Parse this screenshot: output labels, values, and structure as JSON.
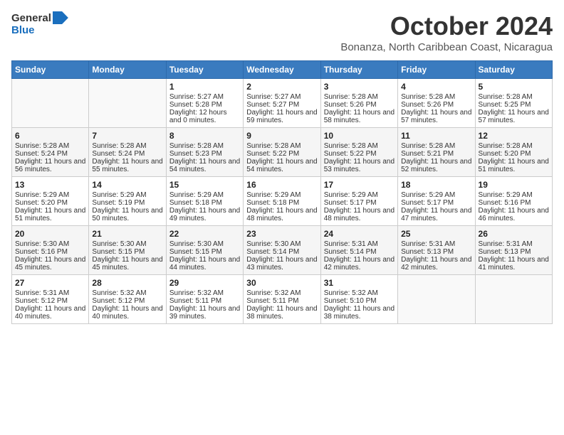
{
  "logo": {
    "general": "General",
    "blue": "Blue"
  },
  "title": "October 2024",
  "subtitle": "Bonanza, North Caribbean Coast, Nicaragua",
  "headers": [
    "Sunday",
    "Monday",
    "Tuesday",
    "Wednesday",
    "Thursday",
    "Friday",
    "Saturday"
  ],
  "weeks": [
    [
      {
        "day": "",
        "sunrise": "",
        "sunset": "",
        "daylight": "",
        "empty": true
      },
      {
        "day": "",
        "sunrise": "",
        "sunset": "",
        "daylight": "",
        "empty": true
      },
      {
        "day": "1",
        "sunrise": "Sunrise: 5:27 AM",
        "sunset": "Sunset: 5:28 PM",
        "daylight": "Daylight: 12 hours and 0 minutes."
      },
      {
        "day": "2",
        "sunrise": "Sunrise: 5:27 AM",
        "sunset": "Sunset: 5:27 PM",
        "daylight": "Daylight: 11 hours and 59 minutes."
      },
      {
        "day": "3",
        "sunrise": "Sunrise: 5:28 AM",
        "sunset": "Sunset: 5:26 PM",
        "daylight": "Daylight: 11 hours and 58 minutes."
      },
      {
        "day": "4",
        "sunrise": "Sunrise: 5:28 AM",
        "sunset": "Sunset: 5:26 PM",
        "daylight": "Daylight: 11 hours and 57 minutes."
      },
      {
        "day": "5",
        "sunrise": "Sunrise: 5:28 AM",
        "sunset": "Sunset: 5:25 PM",
        "daylight": "Daylight: 11 hours and 57 minutes."
      }
    ],
    [
      {
        "day": "6",
        "sunrise": "Sunrise: 5:28 AM",
        "sunset": "Sunset: 5:24 PM",
        "daylight": "Daylight: 11 hours and 56 minutes."
      },
      {
        "day": "7",
        "sunrise": "Sunrise: 5:28 AM",
        "sunset": "Sunset: 5:24 PM",
        "daylight": "Daylight: 11 hours and 55 minutes."
      },
      {
        "day": "8",
        "sunrise": "Sunrise: 5:28 AM",
        "sunset": "Sunset: 5:23 PM",
        "daylight": "Daylight: 11 hours and 54 minutes."
      },
      {
        "day": "9",
        "sunrise": "Sunrise: 5:28 AM",
        "sunset": "Sunset: 5:22 PM",
        "daylight": "Daylight: 11 hours and 54 minutes."
      },
      {
        "day": "10",
        "sunrise": "Sunrise: 5:28 AM",
        "sunset": "Sunset: 5:22 PM",
        "daylight": "Daylight: 11 hours and 53 minutes."
      },
      {
        "day": "11",
        "sunrise": "Sunrise: 5:28 AM",
        "sunset": "Sunset: 5:21 PM",
        "daylight": "Daylight: 11 hours and 52 minutes."
      },
      {
        "day": "12",
        "sunrise": "Sunrise: 5:28 AM",
        "sunset": "Sunset: 5:20 PM",
        "daylight": "Daylight: 11 hours and 51 minutes."
      }
    ],
    [
      {
        "day": "13",
        "sunrise": "Sunrise: 5:29 AM",
        "sunset": "Sunset: 5:20 PM",
        "daylight": "Daylight: 11 hours and 51 minutes."
      },
      {
        "day": "14",
        "sunrise": "Sunrise: 5:29 AM",
        "sunset": "Sunset: 5:19 PM",
        "daylight": "Daylight: 11 hours and 50 minutes."
      },
      {
        "day": "15",
        "sunrise": "Sunrise: 5:29 AM",
        "sunset": "Sunset: 5:18 PM",
        "daylight": "Daylight: 11 hours and 49 minutes."
      },
      {
        "day": "16",
        "sunrise": "Sunrise: 5:29 AM",
        "sunset": "Sunset: 5:18 PM",
        "daylight": "Daylight: 11 hours and 48 minutes."
      },
      {
        "day": "17",
        "sunrise": "Sunrise: 5:29 AM",
        "sunset": "Sunset: 5:17 PM",
        "daylight": "Daylight: 11 hours and 48 minutes."
      },
      {
        "day": "18",
        "sunrise": "Sunrise: 5:29 AM",
        "sunset": "Sunset: 5:17 PM",
        "daylight": "Daylight: 11 hours and 47 minutes."
      },
      {
        "day": "19",
        "sunrise": "Sunrise: 5:29 AM",
        "sunset": "Sunset: 5:16 PM",
        "daylight": "Daylight: 11 hours and 46 minutes."
      }
    ],
    [
      {
        "day": "20",
        "sunrise": "Sunrise: 5:30 AM",
        "sunset": "Sunset: 5:16 PM",
        "daylight": "Daylight: 11 hours and 45 minutes."
      },
      {
        "day": "21",
        "sunrise": "Sunrise: 5:30 AM",
        "sunset": "Sunset: 5:15 PM",
        "daylight": "Daylight: 11 hours and 45 minutes."
      },
      {
        "day": "22",
        "sunrise": "Sunrise: 5:30 AM",
        "sunset": "Sunset: 5:15 PM",
        "daylight": "Daylight: 11 hours and 44 minutes."
      },
      {
        "day": "23",
        "sunrise": "Sunrise: 5:30 AM",
        "sunset": "Sunset: 5:14 PM",
        "daylight": "Daylight: 11 hours and 43 minutes."
      },
      {
        "day": "24",
        "sunrise": "Sunrise: 5:31 AM",
        "sunset": "Sunset: 5:14 PM",
        "daylight": "Daylight: 11 hours and 42 minutes."
      },
      {
        "day": "25",
        "sunrise": "Sunrise: 5:31 AM",
        "sunset": "Sunset: 5:13 PM",
        "daylight": "Daylight: 11 hours and 42 minutes."
      },
      {
        "day": "26",
        "sunrise": "Sunrise: 5:31 AM",
        "sunset": "Sunset: 5:13 PM",
        "daylight": "Daylight: 11 hours and 41 minutes."
      }
    ],
    [
      {
        "day": "27",
        "sunrise": "Sunrise: 5:31 AM",
        "sunset": "Sunset: 5:12 PM",
        "daylight": "Daylight: 11 hours and 40 minutes."
      },
      {
        "day": "28",
        "sunrise": "Sunrise: 5:32 AM",
        "sunset": "Sunset: 5:12 PM",
        "daylight": "Daylight: 11 hours and 40 minutes."
      },
      {
        "day": "29",
        "sunrise": "Sunrise: 5:32 AM",
        "sunset": "Sunset: 5:11 PM",
        "daylight": "Daylight: 11 hours and 39 minutes."
      },
      {
        "day": "30",
        "sunrise": "Sunrise: 5:32 AM",
        "sunset": "Sunset: 5:11 PM",
        "daylight": "Daylight: 11 hours and 38 minutes."
      },
      {
        "day": "31",
        "sunrise": "Sunrise: 5:32 AM",
        "sunset": "Sunset: 5:10 PM",
        "daylight": "Daylight: 11 hours and 38 minutes."
      },
      {
        "day": "",
        "sunrise": "",
        "sunset": "",
        "daylight": "",
        "empty": true
      },
      {
        "day": "",
        "sunrise": "",
        "sunset": "",
        "daylight": "",
        "empty": true
      }
    ]
  ]
}
